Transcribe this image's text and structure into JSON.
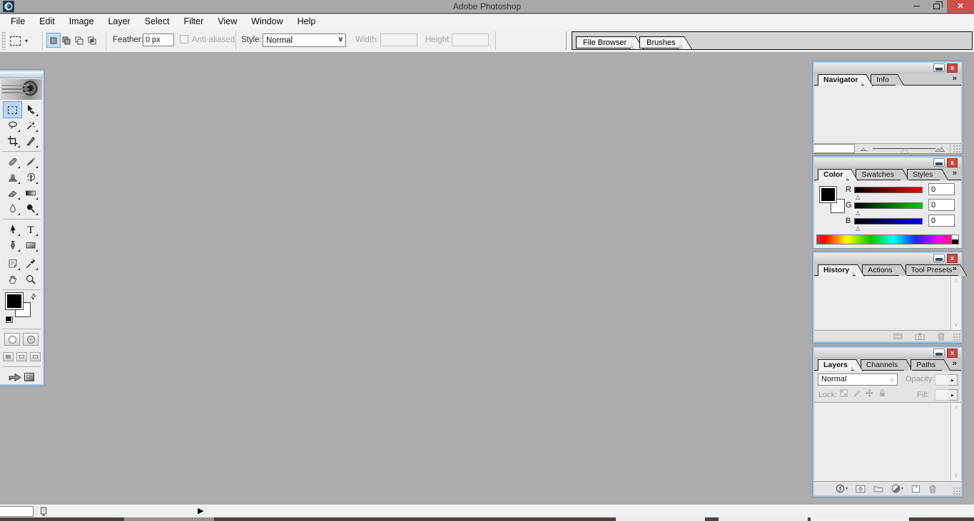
{
  "window": {
    "title": "Adobe Photoshop"
  },
  "menu": {
    "items": [
      "File",
      "Edit",
      "Image",
      "Layer",
      "Select",
      "Filter",
      "View",
      "Window",
      "Help"
    ]
  },
  "options_bar": {
    "feather_label": "Feather:",
    "feather_value": "0 px",
    "anti_aliased_label": "Anti-aliased",
    "style_label": "Style:",
    "style_value": "Normal",
    "width_label": "Width:",
    "width_value": "",
    "height_label": "Height:",
    "height_value": "",
    "well_tabs": [
      "File Browser",
      "Brushes"
    ]
  },
  "toolbox": {
    "selected_tool": "rectangular-marquee",
    "tools": [
      "rectangular-marquee",
      "move",
      "lasso",
      "magic-wand",
      "crop",
      "slice",
      "healing-brush",
      "brush",
      "clone-stamp",
      "history-brush",
      "eraser",
      "gradient",
      "blur",
      "dodge",
      "path-selection",
      "type",
      "pen",
      "rectangle-shape",
      "notes",
      "eyedropper",
      "hand",
      "zoom"
    ]
  },
  "palettes": {
    "navigator": {
      "tabs": [
        "Navigator",
        "Info"
      ],
      "zoom_value": ""
    },
    "color": {
      "tabs": [
        "Color",
        "Swatches",
        "Styles"
      ],
      "channels": [
        {
          "label": "R",
          "value": "0"
        },
        {
          "label": "G",
          "value": "0"
        },
        {
          "label": "B",
          "value": "0"
        }
      ]
    },
    "history": {
      "tabs": [
        "History",
        "Actions",
        "Tool Presets"
      ]
    },
    "layers": {
      "tabs": [
        "Layers",
        "Channels",
        "Paths"
      ],
      "blend_mode": "Normal",
      "opacity_label": "Opacity:",
      "opacity_value": "",
      "lock_label": "Lock:",
      "fill_label": "Fill:",
      "fill_value": ""
    }
  },
  "status_bar": {
    "zoom_value": ""
  },
  "icons": {
    "close_glyph": "x",
    "win_close_glyph": "✕",
    "more": "»",
    "dropdown": "▾",
    "select_arrow": "∨",
    "spinner_arrow": "▸",
    "scroll_up": "∧",
    "scroll_down": "∨",
    "slider_marker": "△",
    "status_menu": "▶"
  },
  "colors": {
    "workspace": "#acacac",
    "palette_border": "#a5c9ee",
    "close_red": "#d0493f",
    "selection_blue": "#b9d7f1",
    "titlebar": "#a9a9a9"
  }
}
